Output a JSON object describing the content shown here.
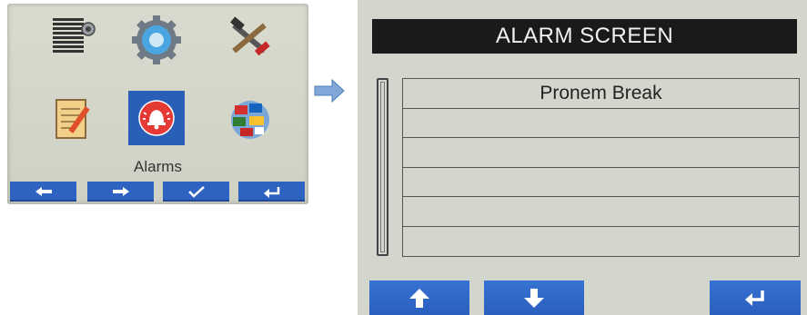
{
  "menu": {
    "icons": [
      {
        "name": "blind-settings-icon"
      },
      {
        "name": "gear-icon"
      },
      {
        "name": "tools-icon"
      },
      {
        "name": "notepad-icon"
      },
      {
        "name": "alarm-bell-icon",
        "selected": true
      },
      {
        "name": "globe-flags-icon"
      }
    ],
    "selected_label": "Alarms",
    "buttons": [
      {
        "icon": "arrow-left-icon"
      },
      {
        "icon": "arrow-right-icon"
      },
      {
        "icon": "checkmark-icon"
      },
      {
        "icon": "return-icon"
      }
    ]
  },
  "alarm_screen": {
    "title": "ALARM SCREEN",
    "rows": [
      "Pronem Break",
      "",
      "",
      "",
      "",
      ""
    ],
    "buttons": [
      {
        "icon": "arrow-up-icon"
      },
      {
        "icon": "arrow-down-icon"
      },
      {
        "icon": "return-icon"
      }
    ]
  },
  "colors": {
    "button_blue": "#2f63c1",
    "selected_blue": "#2a5fb8",
    "title_bar": "#1a1a1a",
    "screen_bg": "#d3d6cd"
  }
}
